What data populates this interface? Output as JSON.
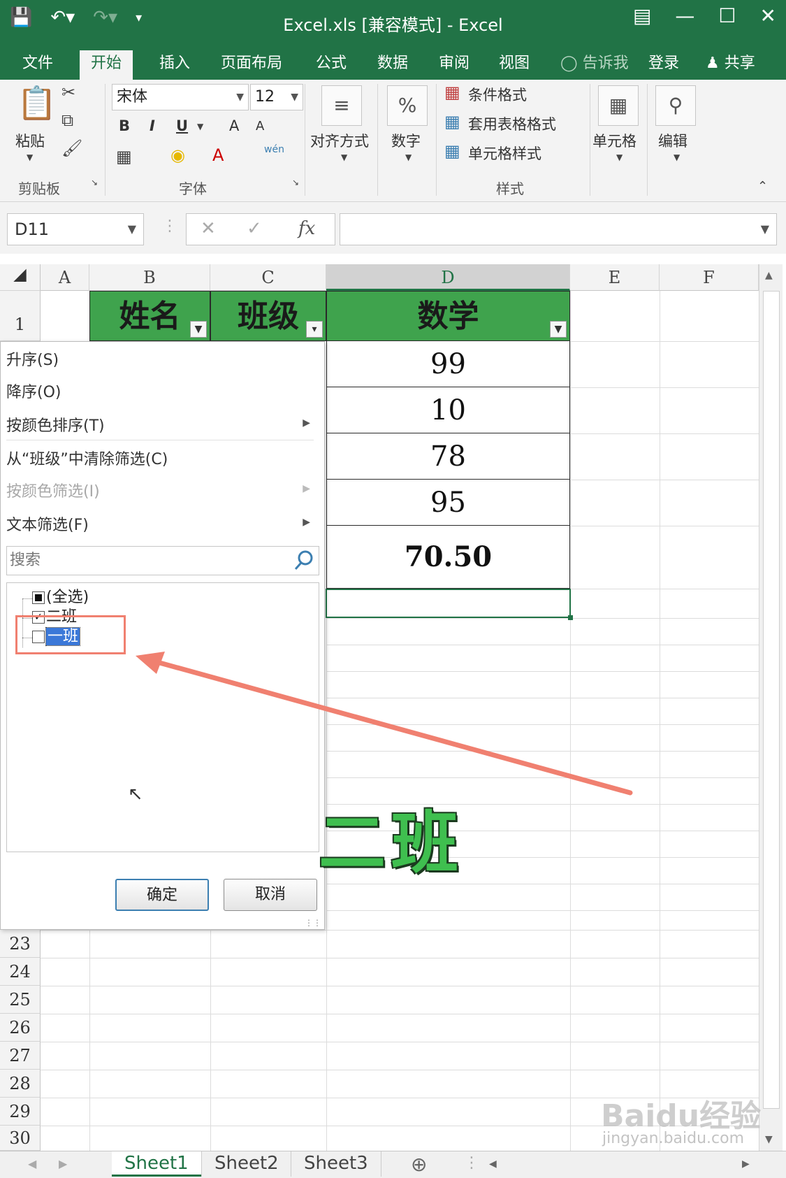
{
  "titlebar": {
    "title": "Excel.xls  [兼容模式] - Excel",
    "save_icon": "save-icon",
    "undo_icon": "undo-icon",
    "redo_icon": "redo-icon"
  },
  "tabs": {
    "file": "文件",
    "home": "开始",
    "insert": "插入",
    "layout": "页面布局",
    "formulas": "公式",
    "data": "数据",
    "review": "审阅",
    "view": "视图",
    "tellme": "告诉我",
    "signin": "登录",
    "share": "共享"
  },
  "ribbon": {
    "paste": "粘贴",
    "clipboard": "剪贴板",
    "font_name": "宋体",
    "font_size": "12",
    "font_group": "字体",
    "bold": "B",
    "italic": "I",
    "underline": "U",
    "grow": "A",
    "shrink": "A",
    "phonetic": "wén",
    "align": "对齐方式",
    "number": "数字",
    "cond_format": "条件格式",
    "table_format": "套用表格格式",
    "cell_style": "单元格样式",
    "styles_group": "样式",
    "cells": "单元格",
    "edit": "编辑"
  },
  "formula_bar": {
    "name_box": "D11",
    "fx": "fx",
    "value": ""
  },
  "grid": {
    "columns": [
      "A",
      "B",
      "C",
      "D",
      "E",
      "F"
    ],
    "row1": "1",
    "headers": {
      "b": "姓名",
      "c": "班级",
      "d": "数学"
    },
    "d_values": [
      "99",
      "10",
      "78",
      "95",
      "70.50"
    ],
    "lower_rows": [
      "23",
      "24",
      "25",
      "26",
      "27",
      "28",
      "29",
      "30"
    ]
  },
  "filter_menu": {
    "sort_asc": "升序(S)",
    "sort_desc": "降序(O)",
    "sort_color": "按颜色排序(T)",
    "clear": "从“班级”中清除筛选(C)",
    "filter_color": "按颜色筛选(I)",
    "text_filter": "文本筛选(F)",
    "search_placeholder": "搜索",
    "items": [
      {
        "label": "(全选)",
        "state": "partial"
      },
      {
        "label": "二班",
        "state": "checked"
      },
      {
        "label": "一班",
        "state": "unchecked"
      }
    ],
    "ok": "确定",
    "cancel": "取消"
  },
  "annotation": {
    "big_text": "二班",
    "color": "#3fbf4f"
  },
  "sheets": [
    "Sheet1",
    "Sheet2",
    "Sheet3"
  ],
  "watermark": {
    "logo": "Baidu经验",
    "url": "jingyan.baidu.com"
  },
  "colors": {
    "excel_green": "#217346",
    "header_fill": "#3fa34d",
    "annotation_red": "#f08070"
  }
}
